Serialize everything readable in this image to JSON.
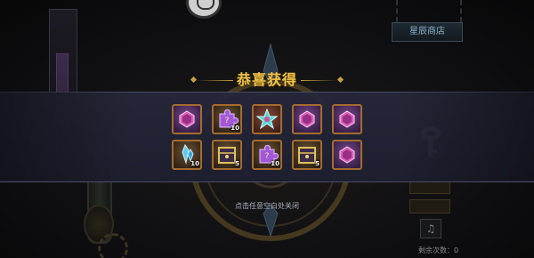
{
  "popup": {
    "title": "恭喜获得",
    "close_hint": "点击任意空白处关闭"
  },
  "rewards": [
    {
      "item": "purple-gem",
      "frame": "purple",
      "qty": ""
    },
    {
      "item": "purple-puzzle",
      "frame": "brown",
      "qty": "10"
    },
    {
      "item": "blue-star",
      "frame": "red",
      "qty": ""
    },
    {
      "item": "purple-gem",
      "frame": "purple",
      "qty": ""
    },
    {
      "item": "purple-gem",
      "frame": "purple",
      "qty": ""
    },
    {
      "item": "blue-crystal",
      "frame": "brown",
      "qty": "10"
    },
    {
      "item": "golden-chest",
      "frame": "brown",
      "qty": "5"
    },
    {
      "item": "purple-puzzle",
      "frame": "brown",
      "qty": "10"
    },
    {
      "item": "golden-chest",
      "frame": "brown",
      "qty": "5"
    },
    {
      "item": "purple-gem",
      "frame": "purple",
      "qty": ""
    }
  ],
  "background": {
    "shop_button": "星辰商店",
    "remaining_label": "剩余次数：0"
  },
  "colors": {
    "title": "#f2c54a",
    "banner": "#232536",
    "slot_border": "#a56b2e"
  }
}
